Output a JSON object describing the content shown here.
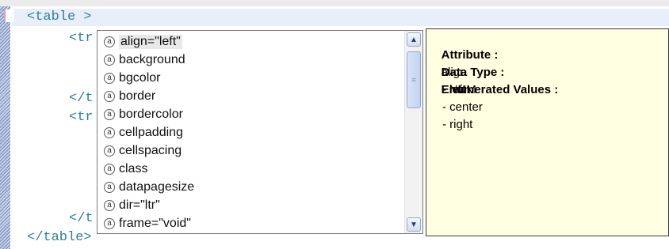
{
  "editor": {
    "lines": [
      {
        "text": "<table >"
      },
      {
        "text": "<tr"
      },
      {
        "text": "</t"
      },
      {
        "text": "<tr"
      },
      {
        "text": "</t"
      },
      {
        "text": "</table>"
      }
    ]
  },
  "completion": {
    "items": [
      {
        "icon": "a",
        "label": "align=\"left\"",
        "selected": true
      },
      {
        "icon": "a",
        "label": "background"
      },
      {
        "icon": "a",
        "label": "bgcolor"
      },
      {
        "icon": "a",
        "label": "border"
      },
      {
        "icon": "a",
        "label": "bordercolor"
      },
      {
        "icon": "a",
        "label": "cellpadding"
      },
      {
        "icon": "a",
        "label": "cellspacing"
      },
      {
        "icon": "a",
        "label": "class"
      },
      {
        "icon": "a",
        "label": "datapagesize"
      },
      {
        "icon": "a",
        "label": "dir=\"ltr\""
      },
      {
        "icon": "a",
        "label": "frame=\"void\""
      }
    ]
  },
  "info": {
    "attribute_label": "Attribute :",
    "attribute_value": "align",
    "datatype_label": "Data Type :",
    "datatype_value": "ENUM",
    "enum_label": "Enumerated Values :",
    "enum_values": [
      "- left",
      "- center",
      "- right"
    ]
  },
  "scrollbar": {
    "up_glyph": "▲",
    "down_glyph": "▼",
    "thumb_glyph": "≡"
  },
  "colors": {
    "code": "#2f7f9a",
    "info_bg": "#ffffe1",
    "gutter": "#6f86b8"
  }
}
